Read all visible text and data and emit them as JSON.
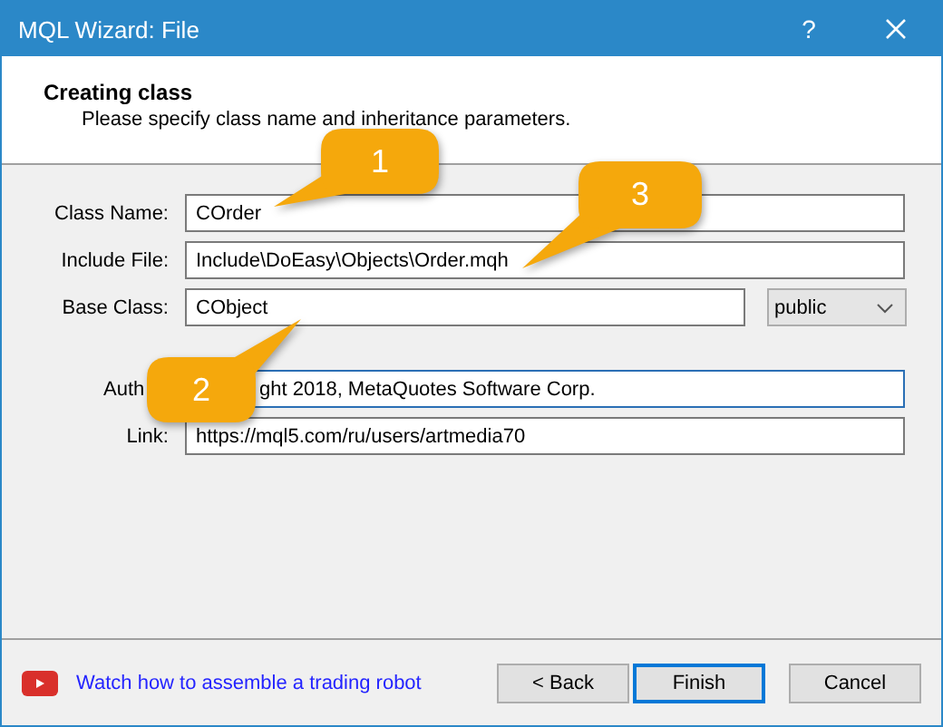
{
  "window": {
    "title": "MQL Wizard: File",
    "help": "?"
  },
  "header": {
    "title": "Creating class",
    "subtitle": "Please specify class name and inheritance parameters."
  },
  "fields": [
    {
      "label": "Class Name:",
      "value": "COrder"
    },
    {
      "label": "Include File:",
      "value": "Include\\DoEasy\\Objects\\Order.mqh"
    },
    {
      "label": "Base Class:",
      "value": "CObject"
    },
    {
      "label": "Auth",
      "value": "ght 2018, MetaQuotes Software Corp."
    },
    {
      "label": "Link:",
      "value": "https://mql5.com/ru/users/artmedia70"
    }
  ],
  "base_access": {
    "value": "public"
  },
  "callouts": [
    {
      "number": "1"
    },
    {
      "number": "3"
    },
    {
      "number": "2"
    }
  ],
  "footer": {
    "video_link": "Watch how to assemble a trading robot",
    "buttons": [
      {
        "label": "< Back",
        "focused": false
      },
      {
        "label": "Finish",
        "focused": true
      },
      {
        "label": "Cancel",
        "focused": false
      }
    ]
  }
}
